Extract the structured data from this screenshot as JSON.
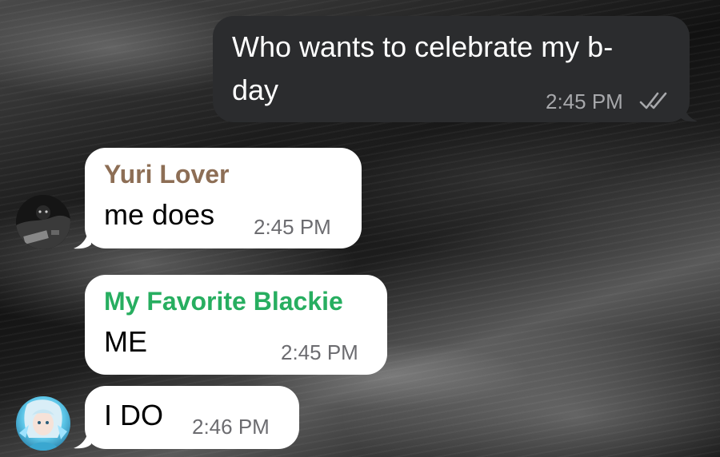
{
  "chat": {
    "messages": [
      {
        "direction": "outgoing",
        "text_line1": "Who wants to celebrate my b-",
        "text_line2": "day",
        "time": "2:45 PM",
        "status_icon": "double-check-icon"
      },
      {
        "direction": "incoming",
        "sender": "Yuri Lover",
        "sender_color": "#8d6e55",
        "text": "me does",
        "time": "2:45 PM",
        "avatar": "dark-photo-avatar"
      },
      {
        "direction": "incoming",
        "sender": "My Favorite Blackie",
        "sender_color": "#27ae60",
        "text": "ME",
        "time": "2:45 PM"
      },
      {
        "direction": "incoming",
        "text": "I DO",
        "time": "2:46 PM",
        "avatar": "anime-character-avatar"
      }
    ]
  },
  "colors": {
    "outgoing_bubble": "#2b2c2e",
    "incoming_bubble": "#ffffff"
  }
}
